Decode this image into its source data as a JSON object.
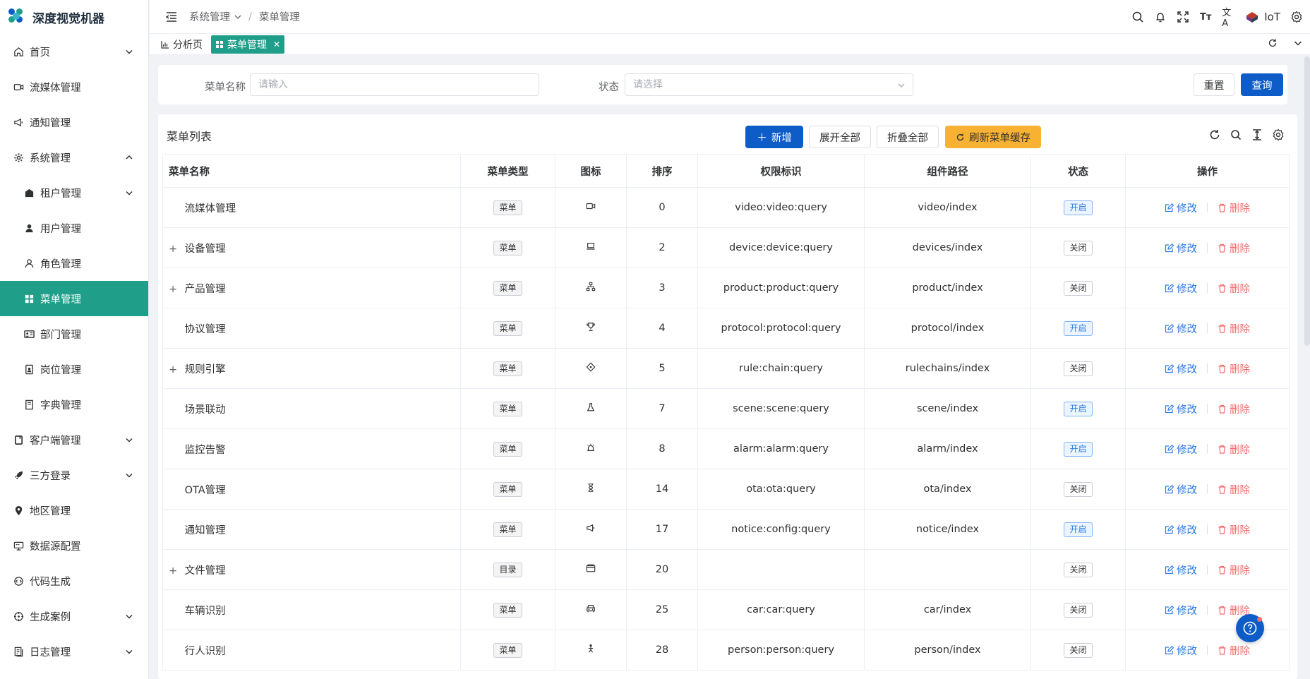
{
  "app": {
    "title": "深度视觉机器"
  },
  "sidebar": {
    "items": [
      {
        "label": "首页",
        "icon": "home-icon",
        "chevron": "down"
      },
      {
        "label": "流媒体管理",
        "icon": "video-icon"
      },
      {
        "label": "通知管理",
        "icon": "megaphone-icon"
      },
      {
        "label": "系统管理",
        "icon": "gear-icon",
        "chevron": "up"
      }
    ],
    "sub_items": [
      {
        "label": "租户管理",
        "icon": "building-icon",
        "chevron": "down"
      },
      {
        "label": "用户管理",
        "icon": "user-icon"
      },
      {
        "label": "角色管理",
        "icon": "user-outline-icon"
      },
      {
        "label": "菜单管理",
        "icon": "grid-icon",
        "active": true
      },
      {
        "label": "部门管理",
        "icon": "id-card-icon"
      },
      {
        "label": "岗位管理",
        "icon": "badge-icon"
      },
      {
        "label": "字典管理",
        "icon": "book-icon"
      }
    ],
    "items2": [
      {
        "label": "客户端管理",
        "icon": "client-icon",
        "chevron": "down"
      },
      {
        "label": "三方登录",
        "icon": "rocket-icon",
        "chevron": "down"
      },
      {
        "label": "地区管理",
        "icon": "location-icon"
      },
      {
        "label": "数据源配置",
        "icon": "monitor-icon"
      },
      {
        "label": "代码生成",
        "icon": "code-icon"
      },
      {
        "label": "生成案例",
        "icon": "target-icon",
        "chevron": "down"
      },
      {
        "label": "日志管理",
        "icon": "log-icon",
        "chevron": "down"
      }
    ]
  },
  "header": {
    "breadcrumb": [
      "系统管理",
      "菜单管理"
    ],
    "user": "IoT"
  },
  "tabs": [
    {
      "label": "分析页",
      "icon": "chart-icon"
    },
    {
      "label": "菜单管理",
      "icon": "grid-icon",
      "active": true
    }
  ],
  "search": {
    "name_label": "菜单名称",
    "name_placeholder": "请输入",
    "status_label": "状态",
    "status_placeholder": "请选择",
    "reset_label": "重置",
    "query_label": "查询"
  },
  "table": {
    "title": "菜单列表",
    "add_label": "新增",
    "expand_label": "展开全部",
    "collapse_label": "折叠全部",
    "refresh_cache_label": "刷新菜单缓存",
    "columns": [
      "菜单名称",
      "菜单类型",
      "图标",
      "排序",
      "权限标识",
      "组件路径",
      "状态",
      "操作"
    ],
    "edit_label": "修改",
    "delete_label": "删除",
    "rows": [
      {
        "name": "流媒体管理",
        "expand": false,
        "type": "菜单",
        "icon": "video-icon",
        "sort": "0",
        "perm": "video:video:query",
        "path": "video/index",
        "status": "开启"
      },
      {
        "name": "设备管理",
        "expand": true,
        "type": "菜单",
        "icon": "laptop-icon",
        "sort": "2",
        "perm": "device:device:query",
        "path": "devices/index",
        "status": "关闭"
      },
      {
        "name": "产品管理",
        "expand": true,
        "type": "菜单",
        "icon": "org-icon",
        "sort": "3",
        "perm": "product:product:query",
        "path": "product/index",
        "status": "关闭"
      },
      {
        "name": "协议管理",
        "expand": false,
        "type": "菜单",
        "icon": "trophy-icon",
        "sort": "4",
        "perm": "protocol:protocol:query",
        "path": "protocol/index",
        "status": "开启"
      },
      {
        "name": "规则引擎",
        "expand": true,
        "type": "菜单",
        "icon": "diamond-icon",
        "sort": "5",
        "perm": "rule:chain:query",
        "path": "rulechains/index",
        "status": "关闭"
      },
      {
        "name": "场景联动",
        "expand": false,
        "type": "菜单",
        "icon": "flask-icon",
        "sort": "7",
        "perm": "scene:scene:query",
        "path": "scene/index",
        "status": "开启"
      },
      {
        "name": "监控告警",
        "expand": false,
        "type": "菜单",
        "icon": "alarm-icon",
        "sort": "8",
        "perm": "alarm:alarm:query",
        "path": "alarm/index",
        "status": "开启"
      },
      {
        "name": "OTA管理",
        "expand": false,
        "type": "菜单",
        "icon": "hourglass-icon",
        "sort": "14",
        "perm": "ota:ota:query",
        "path": "ota/index",
        "status": "关闭"
      },
      {
        "name": "通知管理",
        "expand": false,
        "type": "菜单",
        "icon": "megaphone-icon",
        "sort": "17",
        "perm": "notice:config:query",
        "path": "notice/index",
        "status": "开启"
      },
      {
        "name": "文件管理",
        "expand": true,
        "type": "目录",
        "icon": "folder-icon",
        "sort": "20",
        "perm": "",
        "path": "",
        "status": "关闭"
      },
      {
        "name": "车辆识别",
        "expand": false,
        "type": "菜单",
        "icon": "car-icon",
        "sort": "25",
        "perm": "car:car:query",
        "path": "car/index",
        "status": "关闭"
      },
      {
        "name": "行人识别",
        "expand": false,
        "type": "菜单",
        "icon": "person-icon",
        "sort": "28",
        "perm": "person:person:query",
        "path": "person/index",
        "status": "关闭"
      }
    ]
  }
}
